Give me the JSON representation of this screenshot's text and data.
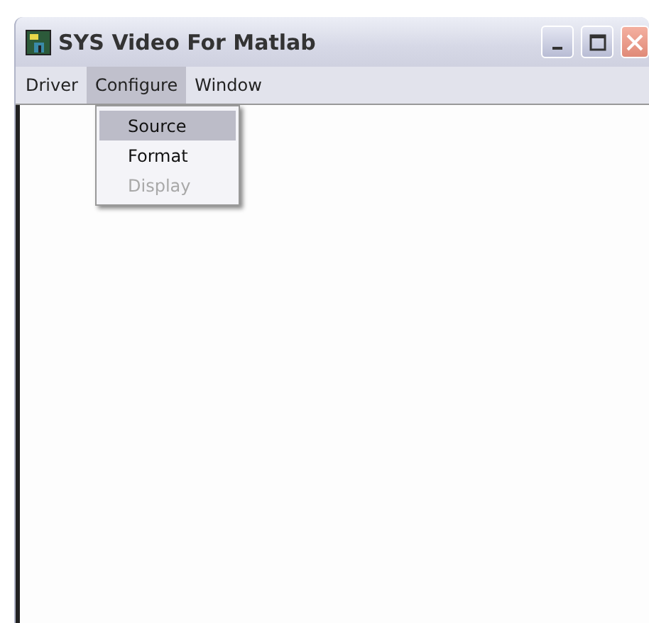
{
  "window": {
    "title": "SYS Video For Matlab"
  },
  "menu_bar": [
    {
      "label": "Driver",
      "selected": false
    },
    {
      "label": "Configure",
      "selected": true
    },
    {
      "label": "Window",
      "selected": false
    }
  ],
  "dropdown": [
    {
      "label": "Source",
      "selected": true,
      "disabled": false
    },
    {
      "label": "Format",
      "selected": false,
      "disabled": false
    },
    {
      "label": "Display",
      "selected": false,
      "disabled": true
    }
  ]
}
